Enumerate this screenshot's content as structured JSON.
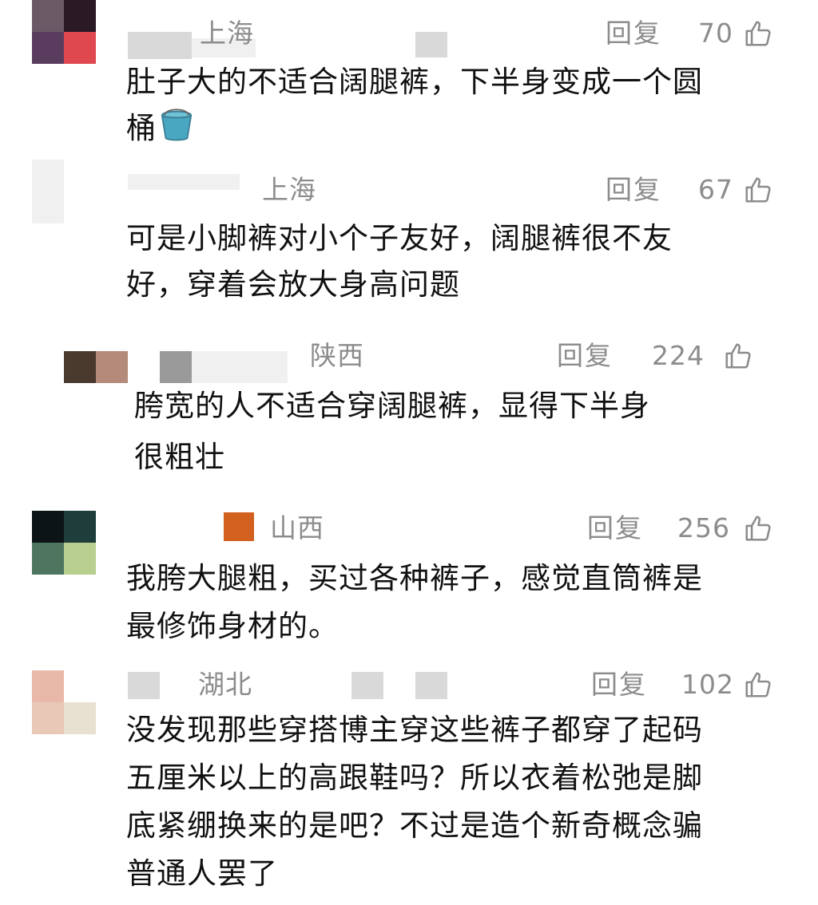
{
  "colors": {
    "meta_text": "#8c8c8c",
    "body_text": "#111111",
    "background": "#ffffff"
  },
  "comments": [
    {
      "region": "上海",
      "reply_label": "回复",
      "likes": "70",
      "lines": [
        "肚子大的不适合阔腿裤，下半身变成一个圆",
        "桶"
      ],
      "emoji": "bucket-icon",
      "avatar_colors": [
        "#6b5a66",
        "#2a1a26",
        "#5a3d5e",
        "#e0484f"
      ]
    },
    {
      "region": "上海",
      "reply_label": "回复",
      "likes": "67",
      "lines": [
        "可是小脚裤对小个子友好，阔腿裤很不友",
        "好，穿着会放大身高问题"
      ],
      "avatar_colors": [
        "#f0f0f0",
        "#ffffff",
        "#f0f0f0",
        "#ffffff"
      ]
    },
    {
      "region": "陕西",
      "reply_label": "回复",
      "likes": "224",
      "lines": [
        "胯宽的人不适合穿阔腿裤，显得下半身",
        "很粗壮"
      ],
      "avatar_colors": [
        "#4a3a2e",
        "#b48a7a",
        "#ffffff",
        "#9a9a9a"
      ]
    },
    {
      "region": "山西",
      "reply_label": "回复",
      "likes": "256",
      "lines": [
        "我胯大腿粗，买过各种裤子，感觉直筒裤是",
        "最修饰身材的。"
      ],
      "avatar_colors": [
        "#0d1416",
        "#1f3d3a",
        "#4e7560",
        "#b8cf8f"
      ]
    },
    {
      "region": "湖北",
      "reply_label": "回复",
      "likes": "102",
      "lines": [
        "没发现那些穿搭博主穿这些裤子都穿了起码",
        "五厘米以上的高跟鞋吗？所以衣着松弛是脚",
        "底紧绷换来的是吧？不过是造个新奇概念骗",
        "普通人罢了"
      ],
      "avatar_colors": [
        "#e8b8a8",
        "#ffffff",
        "#e9c8b8",
        "#e8e0d0"
      ]
    }
  ]
}
